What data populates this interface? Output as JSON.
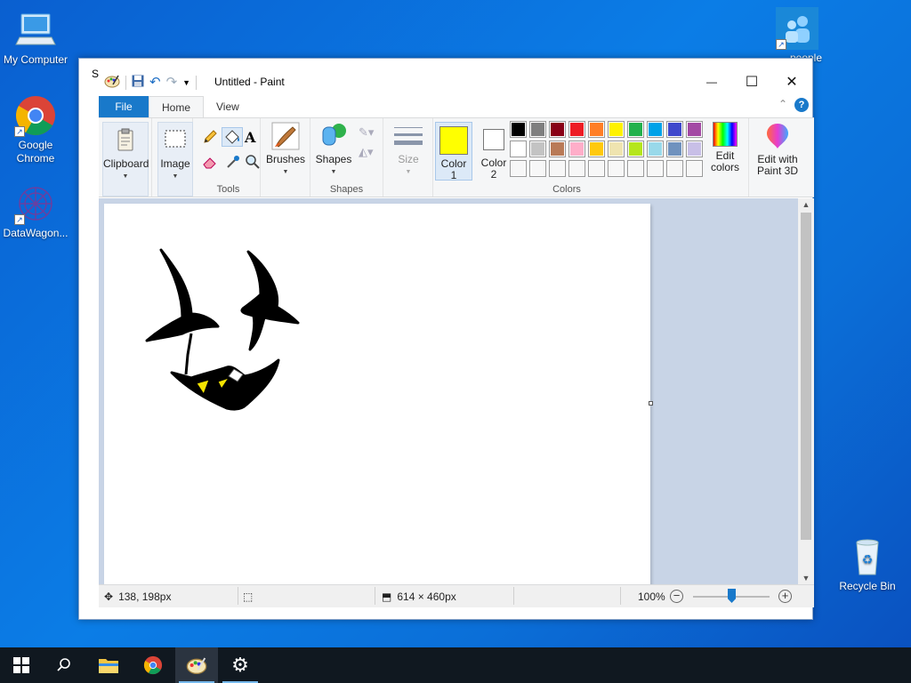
{
  "desktop": {
    "icons": [
      {
        "label": "My Computer"
      },
      {
        "label": "Google Chrome"
      },
      {
        "label": "DataWagon..."
      },
      {
        "label": "people"
      },
      {
        "label": "Recycle Bin"
      }
    ]
  },
  "window": {
    "title_prefix": "S",
    "title": "Untitled - Paint",
    "controls": {
      "minimize": "—",
      "maximize": "☐",
      "close": "✕"
    }
  },
  "ribbon": {
    "tabs": [
      {
        "label": "File"
      },
      {
        "label": "Home"
      },
      {
        "label": "View"
      }
    ],
    "help": "?",
    "groups": {
      "clipboard": {
        "label": "Clipboard"
      },
      "image": {
        "label": "Image"
      },
      "tools": {
        "label": "Tools"
      },
      "brushes": {
        "label": "Brushes"
      },
      "shapes": {
        "label": "Shapes",
        "button": "Shapes"
      },
      "size": {
        "label": "Size"
      },
      "color1": {
        "label_line1": "Color",
        "label_line2": "1",
        "value": "#ffff00"
      },
      "color2": {
        "label_line1": "Color",
        "label_line2": "2",
        "value": "#ffffff"
      },
      "colors": {
        "label": "Colors"
      },
      "edit_colors": {
        "line1": "Edit",
        "line2": "colors"
      },
      "paint3d": {
        "line1": "Edit with",
        "line2": "Paint 3D"
      }
    },
    "palette_row1": [
      "#000000",
      "#7f7f7f",
      "#880015",
      "#ed1c24",
      "#ff7f27",
      "#fff200",
      "#22b14c",
      "#00a2e8",
      "#3f48cc",
      "#a349a4"
    ],
    "palette_row2": [
      "#ffffff",
      "#c3c3c3",
      "#b97a57",
      "#ffaec9",
      "#ffc90e",
      "#efe4b0",
      "#b5e61d",
      "#99d9ea",
      "#7092be",
      "#c8bfe7"
    ],
    "palette_row3": [
      "#ffffff",
      "#ffffff",
      "#ffffff",
      "#ffffff",
      "#ffffff",
      "#ffffff",
      "#ffffff",
      "#ffffff",
      "#ffffff",
      "#ffffff"
    ]
  },
  "status": {
    "cursor_pos": "138, 198px",
    "canvas_size": "614 × 460px",
    "zoom": "100%",
    "zoom_minus": "−",
    "zoom_plus": "+"
  }
}
